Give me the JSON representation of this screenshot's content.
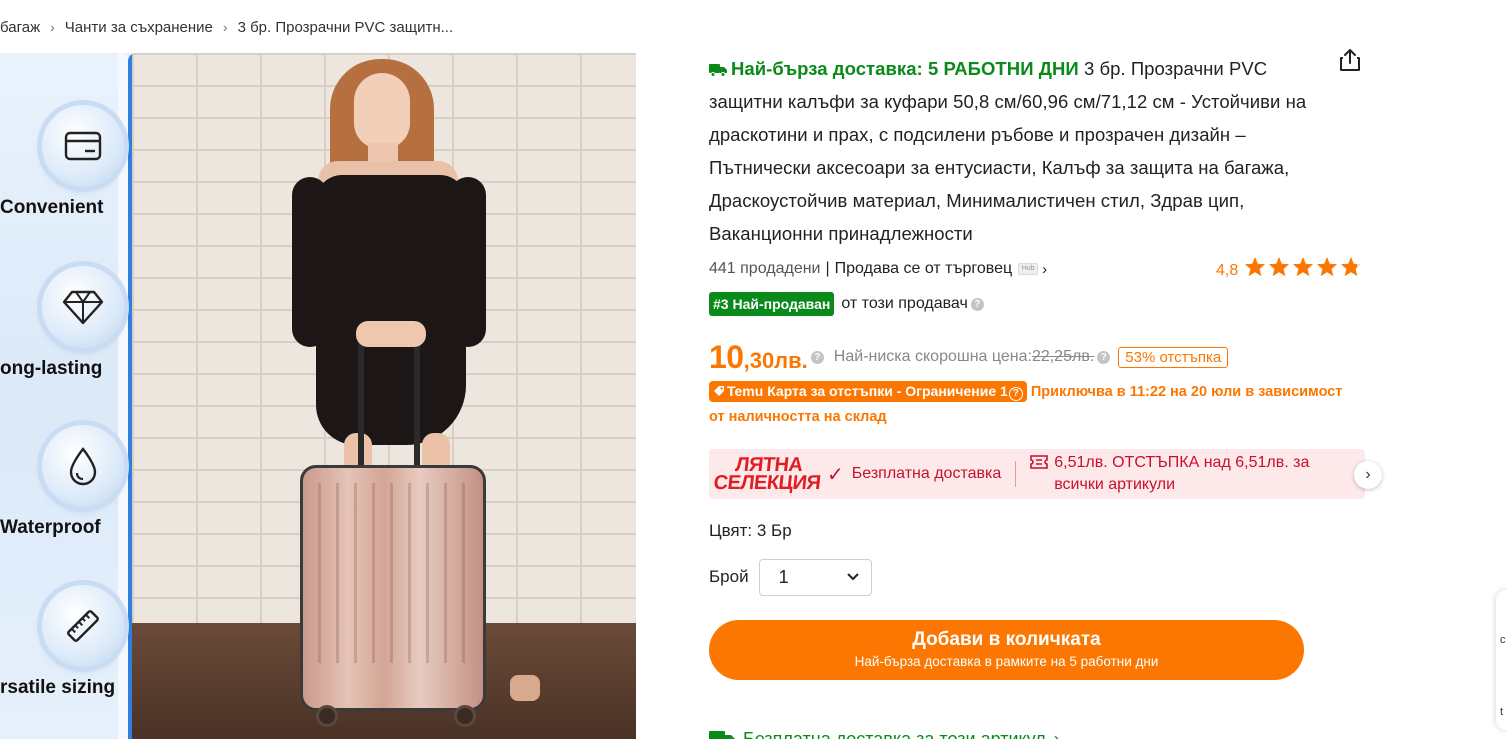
{
  "breadcrumb": {
    "items": [
      "багаж",
      "Чанти за съхранение",
      "3 бр. Прозрачни PVC защитн..."
    ]
  },
  "gallery": {
    "features": [
      {
        "label": "Convenient",
        "icon": "card-icon"
      },
      {
        "label": "ong-lasting",
        "icon": "diamond-icon"
      },
      {
        "label": "Waterproof",
        "icon": "water-drop-icon"
      },
      {
        "label": "rsatile sizing",
        "icon": "ruler-icon"
      }
    ]
  },
  "product": {
    "fast_delivery": "Най-бърза доставка: 5 РАБОТНИ ДНИ",
    "title": "3 бр. Прозрачни PVC защитни калъфи за куфари 50,8 см/60,96 см/71,12 см - Устойчиви на драскотини и прах, с подсилени ръбове и прозрачен дизайн – Пътнически аксесоари за ентусиасти, Калъф за защита на багажа, Драскоустойчив материал, Минималистичен стил, Здрав цип, Ваканционни принадлежности",
    "sold": "441 продадени",
    "seller_text": "Продава се от търговец",
    "rating": "4,8",
    "rating_stars": 4.8,
    "bestseller_badge": "#3 Най-продаван",
    "bestseller_suffix": "от този продавач",
    "price_int": "10",
    "price_frac": ",30лв.",
    "lowest_label": "Най-ниска скорошна цена:",
    "lowest_old": "22,25лв.",
    "discount": "53% отстъпка",
    "temu_card": "Temu Карта за отстъпки - Ограничение 1",
    "temu_card_note": "Приключва в 11:22 на 20 юли в зависимост от наличността на склад",
    "promo_summer_1": "ЛЯТНА",
    "promo_summer_2": "СЕЛЕКЦИЯ",
    "promo_free": "Безплатна доставка",
    "promo_coupon": "6,51лв. ОТСТЪПКА над 6,51лв. за всички артикули",
    "color_label": "Цвят: 3 Бр",
    "qty_label": "Брой",
    "qty_value": "1",
    "add_to_cart": "Добави в количката",
    "add_to_cart_sub": "Най-бърза доставка в рамките на 5 работни дни",
    "free_shipping": "Безплатна доставка за този артикул"
  },
  "colors": {
    "accent_orange": "#fb7701",
    "green": "#0a8a1a",
    "promo_red": "#c8102e",
    "promo_bg": "#fde9ea"
  }
}
